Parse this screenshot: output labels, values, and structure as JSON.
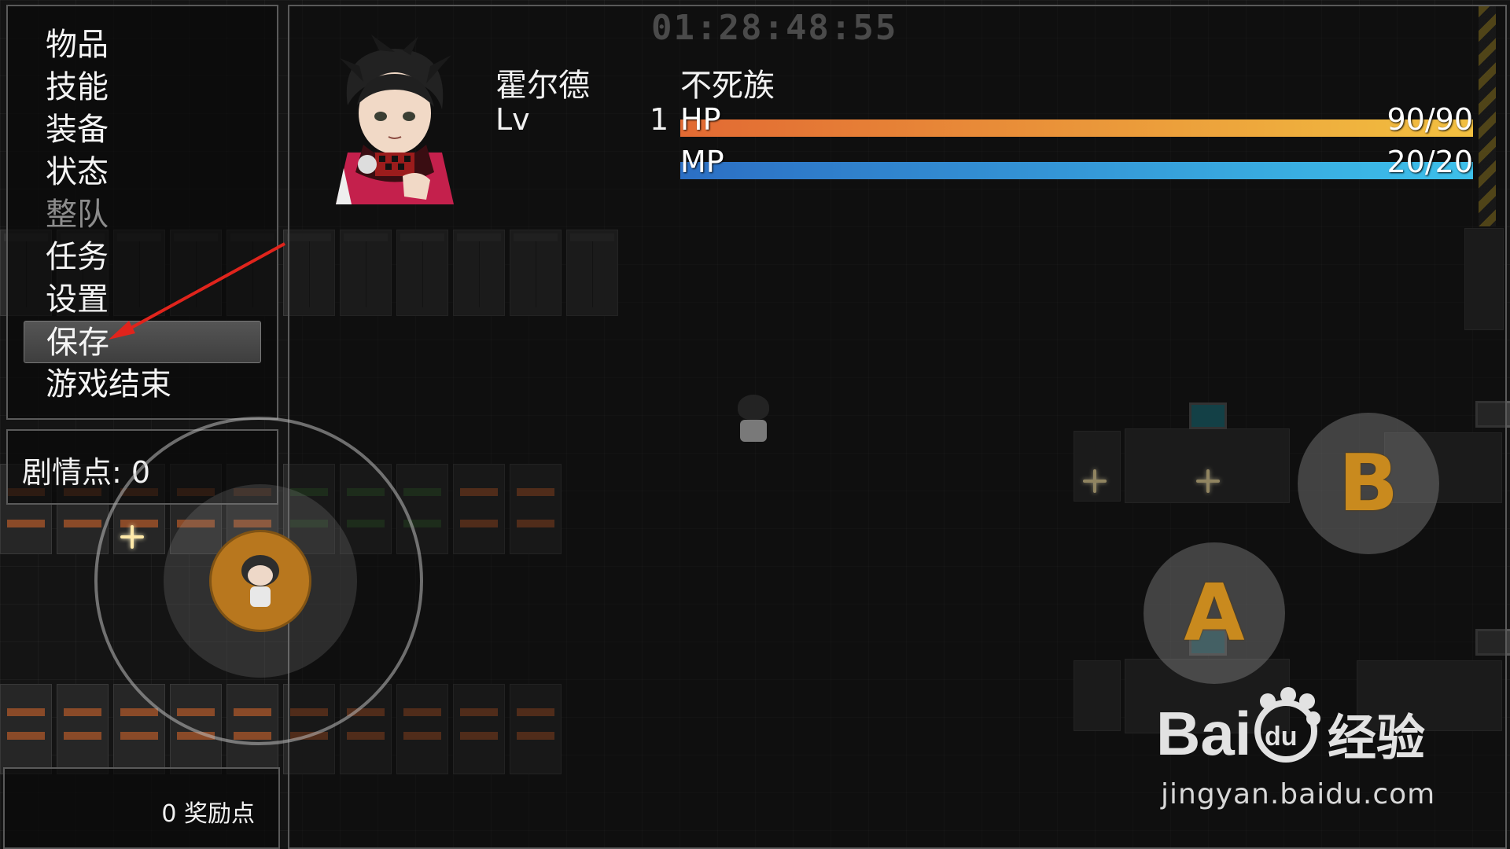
{
  "menu": {
    "items": [
      {
        "label": "物品",
        "enabled": true,
        "selected": false
      },
      {
        "label": "技能",
        "enabled": true,
        "selected": false
      },
      {
        "label": "装备",
        "enabled": true,
        "selected": false
      },
      {
        "label": "状态",
        "enabled": true,
        "selected": false
      },
      {
        "label": "整队",
        "enabled": false,
        "selected": false
      },
      {
        "label": "任务",
        "enabled": true,
        "selected": false
      },
      {
        "label": "设置",
        "enabled": true,
        "selected": false
      },
      {
        "label": "保存",
        "enabled": true,
        "selected": true
      },
      {
        "label": "游戏结束",
        "enabled": true,
        "selected": false
      }
    ]
  },
  "plot_points": {
    "label": "剧情点: 0"
  },
  "reward_points": {
    "label": "0 奖励点"
  },
  "play_time": "01:28:48:55",
  "actor": {
    "name": "霍尔德",
    "class": "不死族",
    "level_label": "Lv",
    "level": "1",
    "hp": {
      "label": "HP",
      "current": 90,
      "max": 90,
      "text": "90/90"
    },
    "mp": {
      "label": "MP",
      "current": 20,
      "max": 20,
      "text": "20/20"
    }
  },
  "controls": {
    "a_button": "A",
    "b_button": "B"
  },
  "watermark": {
    "url": "jingyan.baidu.com"
  },
  "colors": {
    "hp_gradient_start": "#e26a33",
    "hp_gradient_end": "#f2c040",
    "mp_gradient_start": "#2c6fc4",
    "mp_gradient_end": "#3dc0ea",
    "button_letter": "#c98a1e",
    "annotation_arrow": "#e0241c"
  }
}
